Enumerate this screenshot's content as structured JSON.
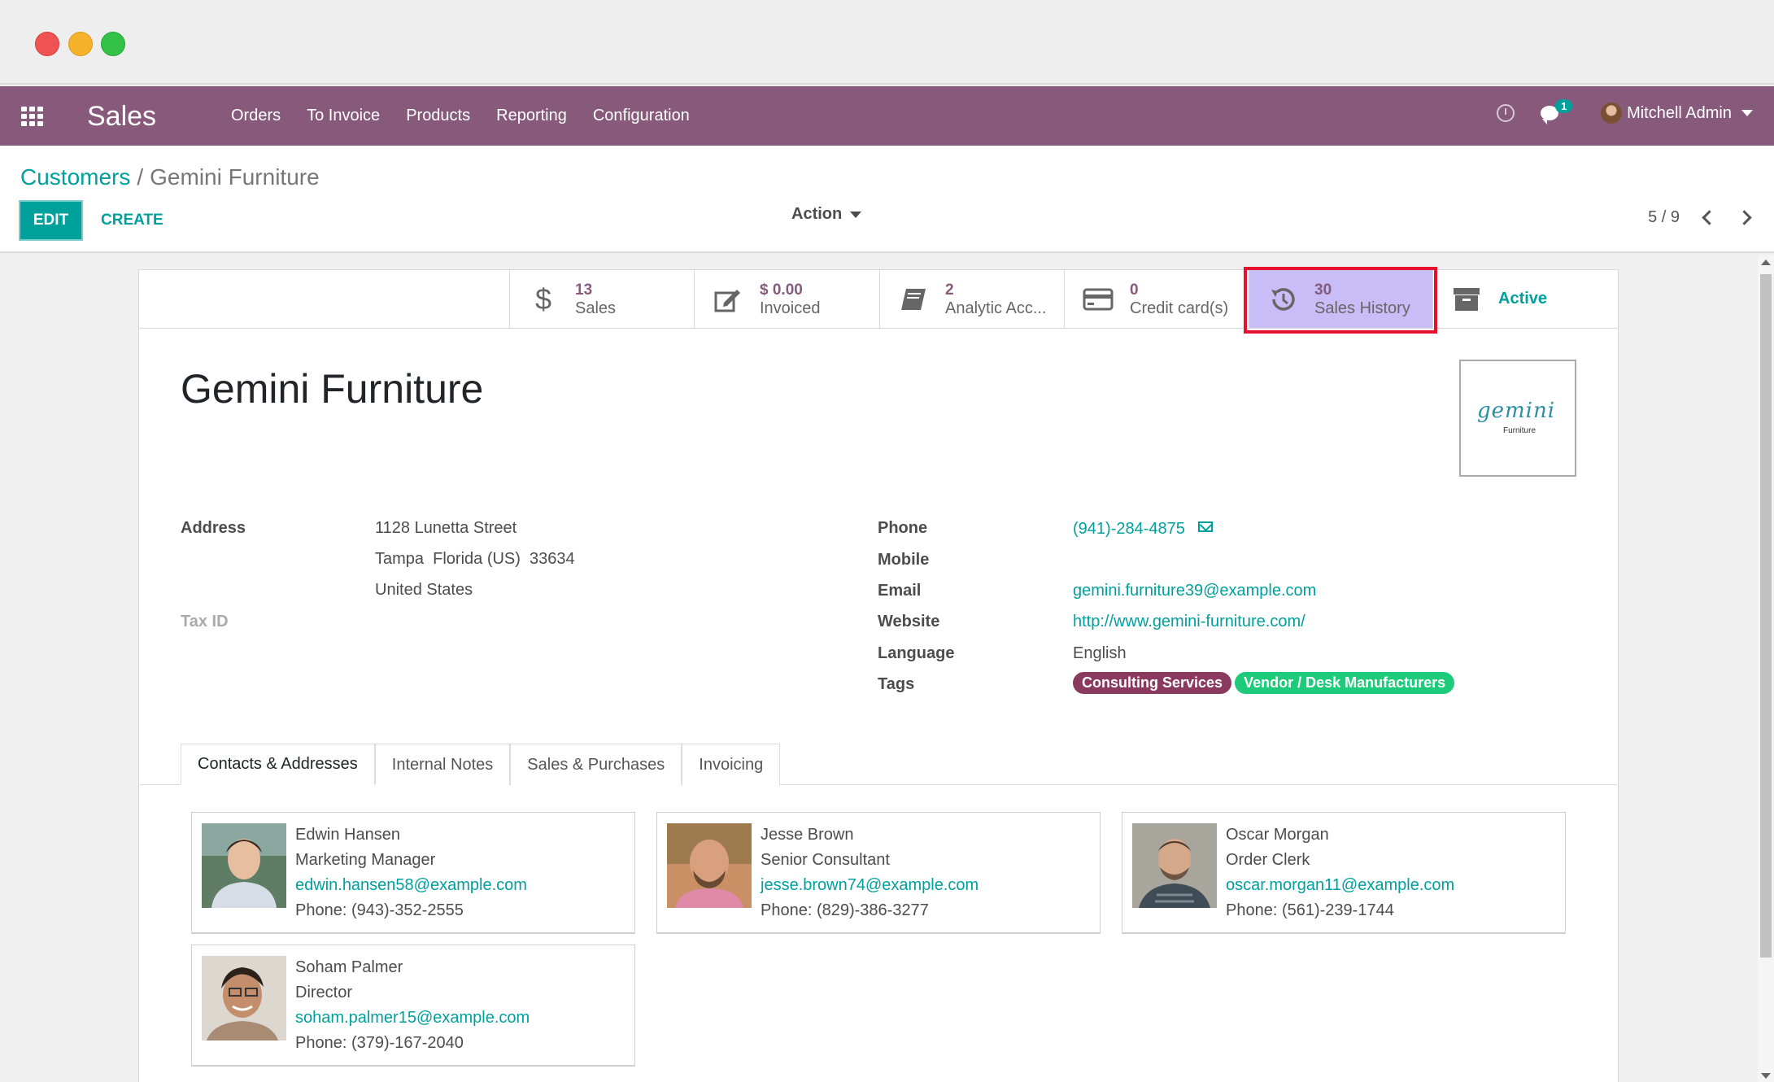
{
  "app": {
    "name": "Sales"
  },
  "menu": [
    "Orders",
    "To Invoice",
    "Products",
    "Reporting",
    "Configuration"
  ],
  "user": {
    "name": "Mitchell Admin",
    "chat_count": "1"
  },
  "breadcrumb": {
    "parent": "Customers",
    "separator": "/",
    "current": "Gemini Furniture"
  },
  "buttons": {
    "edit": "EDIT",
    "create": "CREATE",
    "action": "Action"
  },
  "pager": {
    "text": "5 / 9"
  },
  "smart_buttons": [
    {
      "value": "13",
      "label": "Sales",
      "icon": "dollar-icon"
    },
    {
      "value": "$ 0.00",
      "label": "Invoiced",
      "icon": "edit-icon"
    },
    {
      "value": "2",
      "label": "Analytic Acc...",
      "icon": "book-icon"
    },
    {
      "value": "0",
      "label": "Credit card(s)",
      "icon": "credit-card-icon"
    },
    {
      "value": "30",
      "label": "Sales History",
      "icon": "history-icon"
    },
    {
      "label": "Active",
      "icon": "archive-icon"
    }
  ],
  "partner": {
    "name": "Gemini Furniture",
    "logo_text": "gemini",
    "logo_sub": "Furniture",
    "labels": {
      "address": "Address",
      "tax_id": "Tax ID",
      "phone": "Phone",
      "mobile": "Mobile",
      "email": "Email",
      "website": "Website",
      "language": "Language",
      "tags": "Tags"
    },
    "address_lines": [
      "1128 Lunetta Street",
      "Tampa  Florida (US)  33634",
      "United States"
    ],
    "phone": "(941)-284-4875",
    "mobile": "",
    "email": "gemini.furniture39@example.com",
    "website": "http://www.gemini-furniture.com/",
    "language": "English",
    "tags": [
      {
        "label": "Consulting Services",
        "color": "#8b3a5f"
      },
      {
        "label": "Vendor / Desk Manufacturers",
        "color": "#1ecb7a"
      }
    ]
  },
  "tabs": [
    "Contacts & Addresses",
    "Internal Notes",
    "Sales & Purchases",
    "Invoicing"
  ],
  "contacts": [
    {
      "name": "Edwin Hansen",
      "title": "Marketing Manager",
      "email": "edwin.hansen58@example.com",
      "phone": "Phone: (943)-352-2555"
    },
    {
      "name": "Jesse Brown",
      "title": "Senior Consultant",
      "email": "jesse.brown74@example.com",
      "phone": "Phone: (829)-386-3277"
    },
    {
      "name": "Oscar Morgan",
      "title": "Order Clerk",
      "email": "oscar.morgan11@example.com",
      "phone": "Phone: (561)-239-1744"
    },
    {
      "name": "Soham Palmer",
      "title": "Director",
      "email": "soham.palmer15@example.com",
      "phone": "Phone: (379)-167-2040"
    }
  ],
  "colors": {
    "brand": "#875a7b",
    "accent": "#00a09d",
    "highlight": "#c8bdf7",
    "highlight_border": "#e8112d"
  }
}
